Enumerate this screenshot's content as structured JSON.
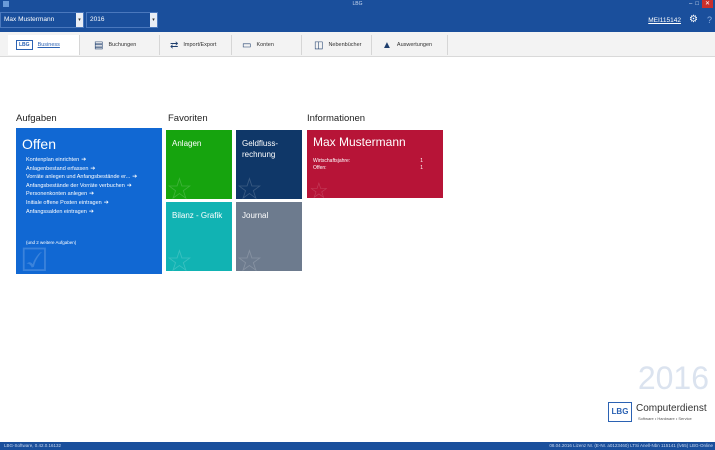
{
  "window": {
    "title": "LBG"
  },
  "selectors": {
    "user": "Max Mustermann",
    "year": "2016",
    "user_code": "MEI115142"
  },
  "ribbon": {
    "logo_text": "LBG",
    "tabs": [
      {
        "label": "Business",
        "icon": "lbg-logo-icon"
      },
      {
        "label": "Buchungen",
        "icon": "ledger-icon"
      },
      {
        "label": "Import/Export",
        "icon": "import-export-icon"
      },
      {
        "label": "Konten",
        "icon": "accounts-icon"
      },
      {
        "label": "Nebenbücher",
        "icon": "subledger-icon"
      },
      {
        "label": "Auswertungen",
        "icon": "chart-icon"
      }
    ]
  },
  "sections": {
    "tasks": "Aufgaben",
    "favorites": "Favoriten",
    "information": "Informationen"
  },
  "open_tasks": {
    "title": "Offen",
    "items": [
      "Kontenplan einrichten",
      "Anlagenbestand erfassen",
      "Vorräte anlegen und Anfangsbestände er...",
      "Anfangsbestände der Vorräte verbuchen",
      "Personenkonten anlegen",
      "Initiale offene Posten eintragen",
      "Anfangssalden eintragen"
    ],
    "more": "(und 2 weitere Aufgaben)"
  },
  "favorites": [
    {
      "label": "Anlagen",
      "color": "#16a40e"
    },
    {
      "label": "Geldfluss-\nrechnung",
      "color": "#0f3768"
    },
    {
      "label": "Bilanz - Grafik",
      "color": "#11b3b3"
    },
    {
      "label": "Journal",
      "color": "#6d7b8e"
    }
  ],
  "info": {
    "name": "Max Mustermann",
    "rows": [
      {
        "label": "Wirtschaftsjahre:",
        "value": "1"
      },
      {
        "label": "Offen:",
        "value": "1"
      }
    ],
    "color": "#b71437"
  },
  "branding": {
    "year": "2016",
    "logo": "LBG",
    "company": "Computerdienst",
    "tagline": "Software • Hardware • Service"
  },
  "statusbar": {
    "left": "LBG-Software, 0.42.0.16132",
    "right": "08.04.2016   Lizenz Nr. (E-Nr. a0123460)  LTSi  Anell-Nbn  115141 (lv55)   LBG-Online"
  },
  "colors": {
    "accent": "#1a4f9c",
    "tasks_tile": "#1168d3"
  }
}
